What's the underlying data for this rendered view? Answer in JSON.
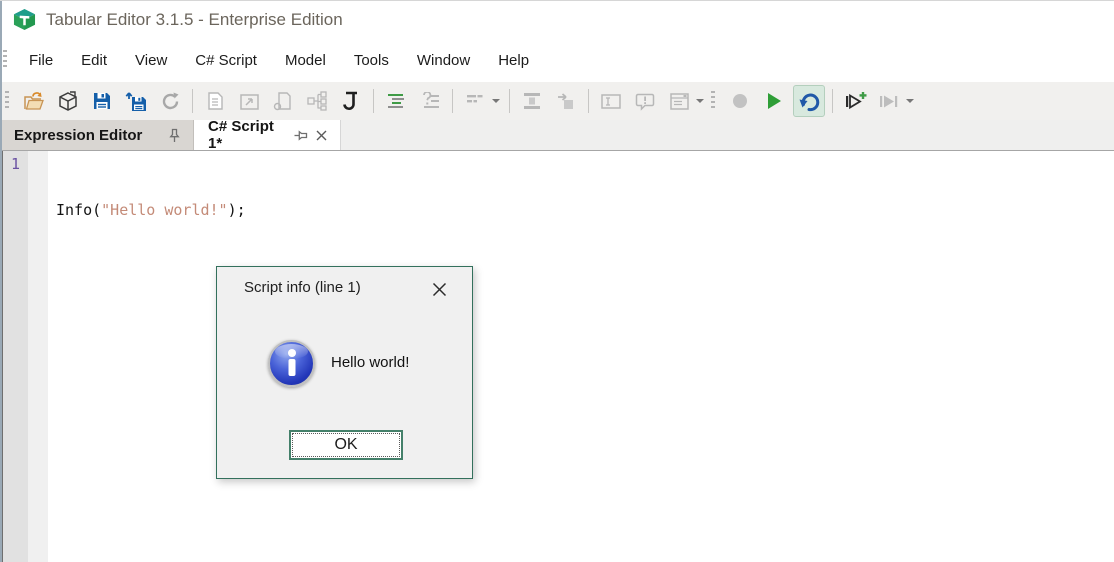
{
  "window": {
    "title": "Tabular Editor 3.1.5 - Enterprise Edition",
    "app_icon": "tabular-editor-cube-logo"
  },
  "menu": {
    "items": [
      {
        "label": "File"
      },
      {
        "label": "Edit"
      },
      {
        "label": "View"
      },
      {
        "label": "C# Script"
      },
      {
        "label": "Model"
      },
      {
        "label": "Tools"
      },
      {
        "label": "Window"
      },
      {
        "label": "Help"
      }
    ]
  },
  "toolbar": {
    "buttons": [
      "open-file",
      "open-model",
      "save",
      "save-as-folder",
      "refresh",
      "new-document",
      "preview-window",
      "page-reference",
      "hierarchy",
      "csharp-script",
      "format-code",
      "comment-lines",
      "sort-list",
      "insert-column",
      "move-into",
      "textbox",
      "message-bubble",
      "window-list",
      "record-macro",
      "run-script",
      "undo",
      "run-new-script",
      "run-to-cursor"
    ],
    "enabled": [
      "open-file",
      "open-model",
      "save",
      "save-as-folder",
      "csharp-script",
      "format-code",
      "run-script",
      "undo",
      "run-new-script"
    ],
    "highlighted": "undo"
  },
  "tabs": {
    "items": [
      {
        "label": "Expression Editor",
        "pin": "pinned",
        "active": false
      },
      {
        "label": "C# Script 1*",
        "pin": "unpinned",
        "closable": true,
        "active": true
      }
    ]
  },
  "editor": {
    "lines": [
      {
        "number": "1",
        "segments": [
          {
            "text": "Info(",
            "kind": "code"
          },
          {
            "text": "\"Hello world!\"",
            "kind": "string"
          },
          {
            "text": ");",
            "kind": "code"
          }
        ]
      }
    ]
  },
  "dialog": {
    "title": "Script info (line 1)",
    "message": "Hello world!",
    "ok_label": "OK",
    "icon": "info-icon"
  },
  "colors": {
    "brand_green": "#2aa158",
    "brand_teal": "#1f9d8b",
    "save_blue": "#155fa9",
    "play_green": "#2f9e37",
    "undo_blue": "#2058a8",
    "undo_highlight_bg": "#d8e9de",
    "string_literal": "#c48b78",
    "line_number_purple": "#6b52a3",
    "dialog_border_green": "#33705c",
    "info_icon_blue": "#2236b8",
    "title_text_gray": "#6b655c"
  }
}
